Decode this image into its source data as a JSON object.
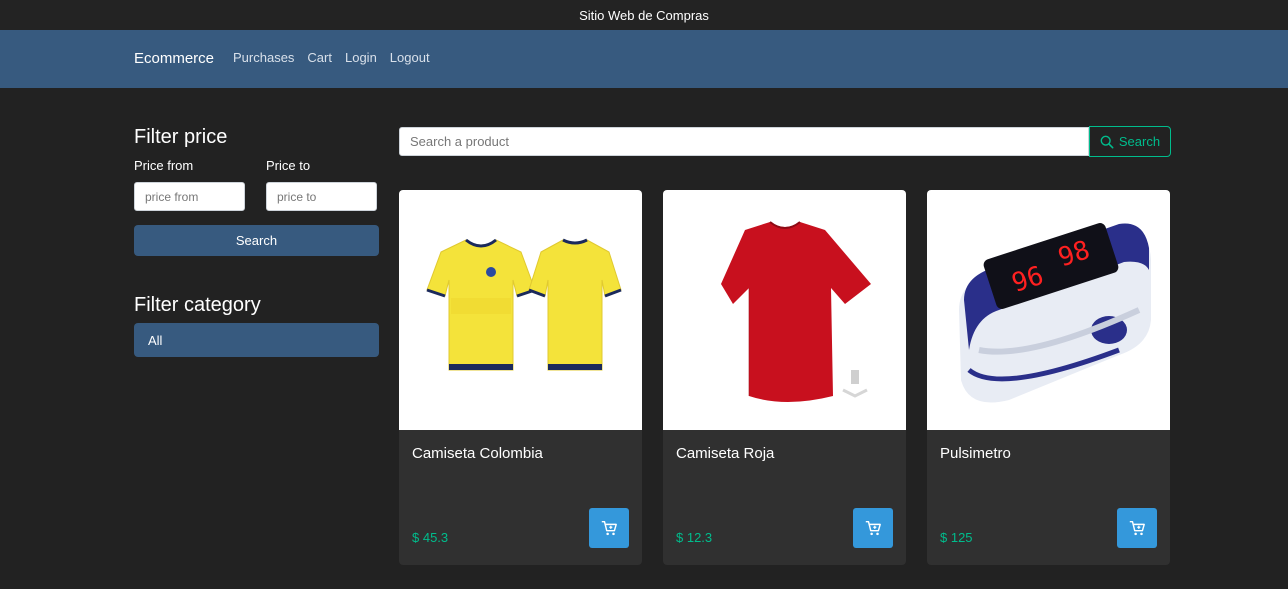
{
  "window": {
    "title": "Sitio Web de Compras"
  },
  "navbar": {
    "brand": "Ecommerce",
    "links": [
      "Purchases",
      "Cart",
      "Login",
      "Logout"
    ]
  },
  "sidebar": {
    "filter_price": {
      "title": "Filter price",
      "from_label": "Price from",
      "to_label": "Price to",
      "from_placeholder": "price from",
      "to_placeholder": "price to",
      "button_label": "Search"
    },
    "filter_category": {
      "title": "Filter category",
      "items": [
        "All"
      ]
    }
  },
  "search": {
    "placeholder": "Search a product",
    "button_label": "Search"
  },
  "products": [
    {
      "name": "Camiseta Colombia",
      "price": "$ 45.3"
    },
    {
      "name": "Camiseta Roja",
      "price": "$ 12.3"
    },
    {
      "name": "Pulsimetro",
      "price": "$ 125"
    }
  ],
  "colors": {
    "background": "#222222",
    "navbar": "#375a7f",
    "accent_green": "#00bc8c",
    "cart_button": "#3498db",
    "card": "#303030"
  },
  "icons": {
    "search_button": "search-icon",
    "cart_button": "cart-icon"
  }
}
